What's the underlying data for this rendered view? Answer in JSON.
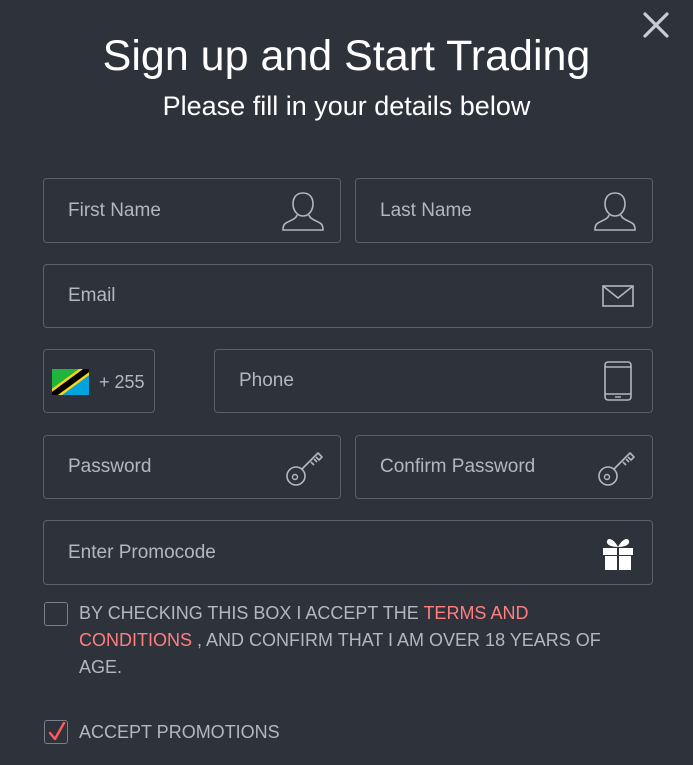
{
  "header": {
    "title": "Sign up and Start Trading",
    "subtitle": "Please fill in your details below"
  },
  "form": {
    "first_name": {
      "placeholder": "First Name",
      "value": "",
      "icon": "user-icon"
    },
    "last_name": {
      "placeholder": "Last Name",
      "value": "",
      "icon": "user-icon"
    },
    "email": {
      "placeholder": "Email",
      "value": "",
      "icon": "envelope-icon"
    },
    "phone_prefix": {
      "dial_code": "+ 255",
      "flag": "tanzania-flag-icon"
    },
    "phone": {
      "placeholder": "Phone",
      "value": "",
      "icon": "mobile-phone-icon"
    },
    "password": {
      "placeholder": "Password",
      "value": "",
      "icon": "key-icon"
    },
    "confirm_password": {
      "placeholder": "Confirm Password",
      "value": "",
      "icon": "key-icon"
    },
    "promocode": {
      "placeholder": "Enter Promocode",
      "value": "",
      "icon": "gift-icon"
    }
  },
  "terms": {
    "checked": false,
    "text_before": "BY CHECKING THIS BOX I ACCEPT THE ",
    "link_text": "TERMS AND CONDITIONS",
    "text_after": " ,  AND CONFIRM THAT I AM OVER 18 YEARS OF AGE."
  },
  "promotions": {
    "checked": true,
    "label": "ACCEPT PROMOTIONS"
  },
  "colors": {
    "background": "#2e323b",
    "field_border": "#5b606a",
    "placeholder": "#b4b7bd",
    "link": "#ff7f80",
    "check": "#ff5a5f"
  }
}
